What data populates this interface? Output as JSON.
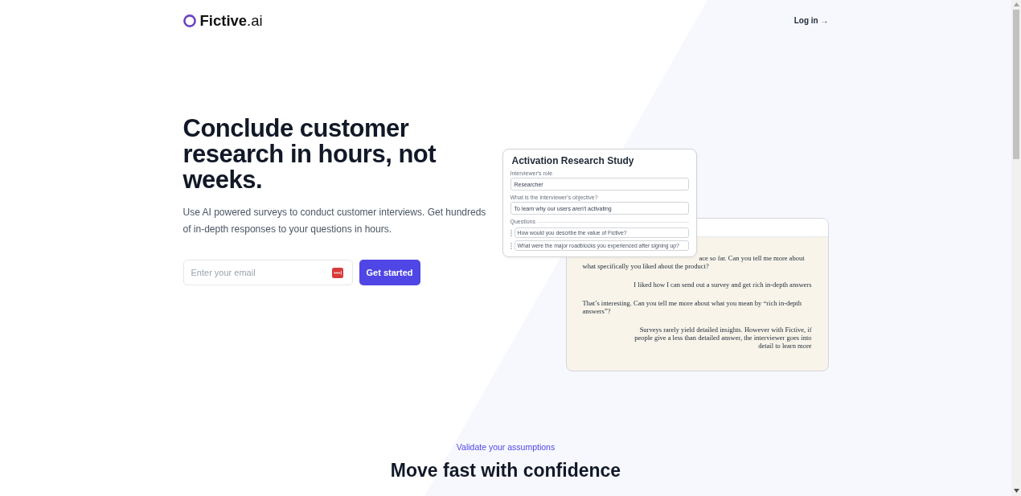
{
  "header": {
    "logo": "**Fictive**.ai",
    "login_link": "Log in →"
  },
  "hero": {
    "headline": "Conclude customer research in hours, not weeks.",
    "description": "Use AI powered surveys to conduct customer interviews. Get hundreds of in-depth responses to your questions in hours.",
    "email_field": {
      "placeholder": "Enter your email"
    },
    "cta_button": "Get started"
  },
  "study_card": {
    "title": "Activation Research Study",
    "fields": [
      {
        "label": "Interviewer's role",
        "value": "Researcher"
      },
      {
        "label": "What is the interviewer's objective?",
        "value": "To learn why our users aren't activating"
      }
    ],
    "questions_label": "Questions",
    "questions": [
      "How would you describe the value of Fictive?",
      "What were the major roadblocks you experienced after signing up?"
    ]
  },
  "chat_card": {
    "messages": [
      {
        "kind": "interviewer",
        "text": "ace so far. Can you tell me more about what specifically you liked about the product?"
      },
      {
        "kind": "respondent",
        "text": "I liked how I can send out a survey and get rich in-depth answers"
      },
      {
        "kind": "interviewer",
        "text": "That’s interesting. Can you tell me more about what you mean by “rich in-depth answers”?"
      },
      {
        "kind": "respondent",
        "text": "Surveys rarely yield detailed insights. However with Fictive, if people give a less than detailed answer, the interviewer goes into detail to learn more"
      }
    ]
  },
  "section": {
    "eyebrow": "Validate your assumptions",
    "heading": "Move fast with confidence"
  }
}
